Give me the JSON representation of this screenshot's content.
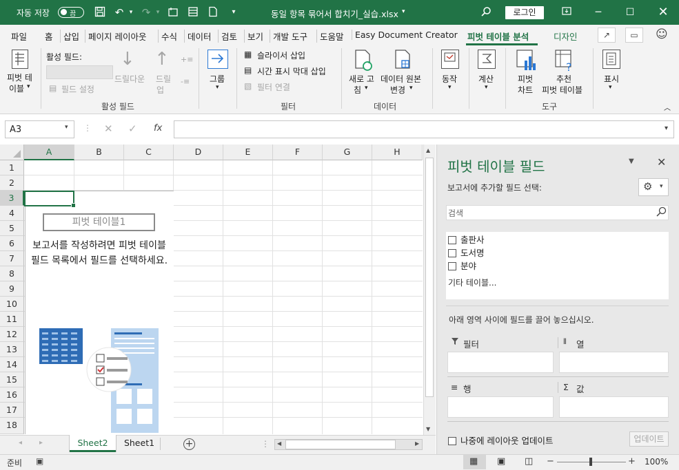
{
  "titlebar": {
    "autosave_label": "자동 저장",
    "autosave_state": "끔",
    "filename": "동일 항목 묶어서 합치기_실습.xlsx",
    "login_label": "로그인",
    "bg_color": "#217346"
  },
  "menu": {
    "tabs": [
      "파일",
      "홈",
      "삽입",
      "페이지 레이아웃",
      "수식",
      "데이터",
      "검토",
      "보기",
      "개발 도구",
      "도움말",
      "Easy Document Creator",
      "피벗 테이블 분석",
      "디자인"
    ],
    "active": "피벗 테이블 분석"
  },
  "ribbon": {
    "pivot_table_l1": "피벗 테",
    "pivot_table_l2": "이블",
    "active_field_label": "활성 필드:",
    "field_settings": "필드 설정",
    "drill_down": "드릴다운",
    "drill_up_l1": "드릴",
    "drill_up_l2": "업",
    "group": "그룹",
    "group_active_field": "활성 필드",
    "insert_slicer": "슬라이서 삽입",
    "insert_timeline": "시간 표시 막대 삽입",
    "filter_connections": "필터 연결",
    "group_filter": "필터",
    "refresh_l1": "새로 고",
    "refresh_l2": "침",
    "data_source_l1": "데이터 원본",
    "data_source_l2": "변경",
    "group_data": "데이터",
    "actions": "동작",
    "calculations": "계산",
    "pivot_chart_l1": "피벗",
    "pivot_chart_l2": "차트",
    "recommended_l1": "추천",
    "recommended_l2": "피벗 테이블",
    "group_tools": "도구",
    "show": "표시"
  },
  "formula_bar": {
    "name_box": "A3",
    "fx": "fx",
    "formula": ""
  },
  "grid": {
    "columns": [
      "A",
      "B",
      "C",
      "D",
      "E",
      "F",
      "G",
      "H"
    ],
    "rows": [
      "1",
      "2",
      "3",
      "4",
      "5",
      "6",
      "7",
      "8",
      "9",
      "10",
      "11",
      "12",
      "13",
      "14",
      "15",
      "16",
      "17",
      "18"
    ],
    "selected_col": "A",
    "selected_row": "3",
    "pivot_name": "피벗 테이블1",
    "pivot_message": "보고서를 작성하려면 피벗 테이블 필드 목록에서 필드를 선택하세요."
  },
  "sheets": {
    "tabs": [
      "Sheet2",
      "Sheet1"
    ],
    "active": "Sheet2"
  },
  "status": {
    "ready": "준비",
    "zoom": "100%",
    "zoom_level": 1.0
  },
  "pivot_pane": {
    "title": "피벗 테이블 필드",
    "choose_fields": "보고서에 추가할 필드 선택:",
    "search_placeholder": "검색",
    "fields": [
      "출판사",
      "도서명",
      "분야"
    ],
    "more_tables": "기타 테이블...",
    "drag_hint": "아래 영역 사이에 필드를 끌어 놓으십시오.",
    "areas": {
      "filters": "필터",
      "columns": "열",
      "rows": "행",
      "values": "값"
    },
    "defer_update": "나중에 레이아웃 업데이트",
    "update_button": "업데이트"
  }
}
